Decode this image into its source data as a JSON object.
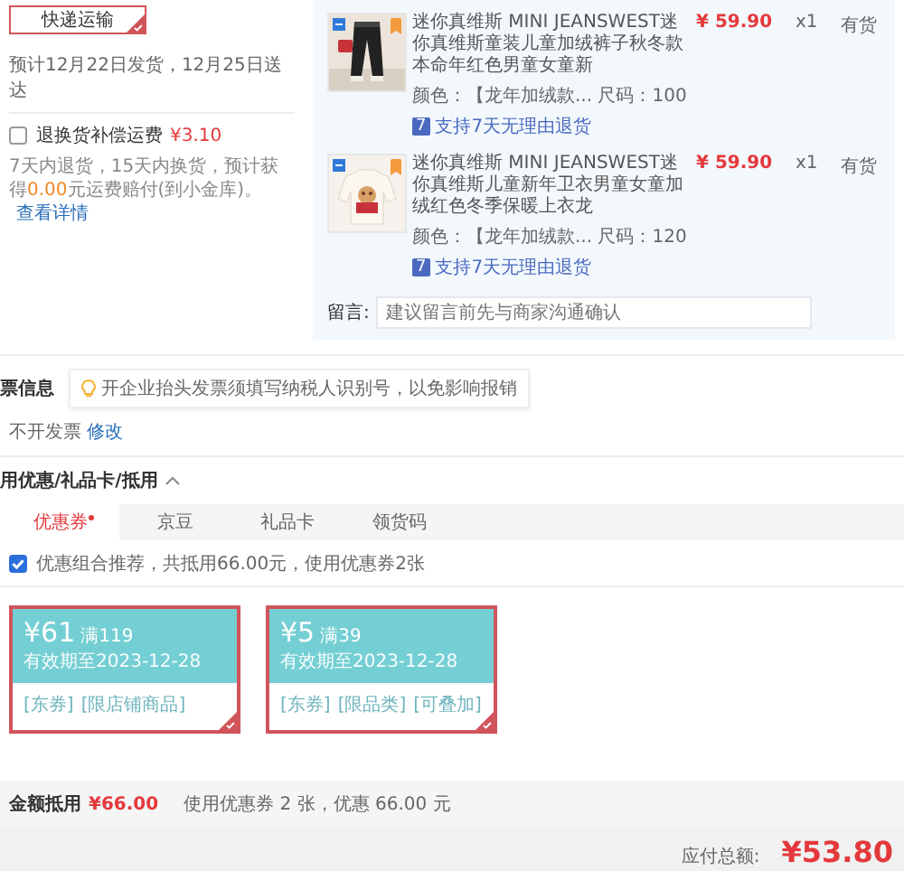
{
  "shipping": {
    "button": "快递运输",
    "selected": true,
    "estimate": "预计12月22日发货，12月25日送达"
  },
  "freight_insurance": {
    "label": "退换货补偿运费",
    "checked": false,
    "price": "¥3.10",
    "description_before": "7天内退货，15天内换货，预计获得",
    "amount": "0.00",
    "description_after": "元运费赔付(到小金库)。",
    "link": "查看详情"
  },
  "products": [
    {
      "title": "迷你真维斯 MINI JEANSWEST迷你真维斯童装儿童加绒裤子秋冬款本命年红色男童女童新",
      "variant": "颜色：【龙年加绒款... 尺码：100",
      "service_badge": "7",
      "service": "支持7天无理由退货",
      "price": "¥ 59.90",
      "quantity": "x1",
      "stock": "有货",
      "kind": "pants"
    },
    {
      "title": "迷你真维斯 MINI JEANSWEST迷你真维斯儿童新年卫衣男童女童加绒红色冬季保暖上衣龙",
      "variant": "颜色：【龙年加绒款... 尺码：120",
      "service_badge": "7",
      "service": "支持7天无理由退货",
      "price": "¥ 59.90",
      "quantity": "x1",
      "stock": "有货",
      "kind": "sweater"
    }
  ],
  "message": {
    "label": "留言:",
    "placeholder": "建议留言前先与商家沟通确认"
  },
  "invoice": {
    "title": "票信息",
    "tip": "开企业抬头发票须填写纳税人识别号，以免影响报销",
    "value": "不开发票",
    "link": "修改"
  },
  "discounts": {
    "title": "用优惠/礼品卡/抵用",
    "expanded": true,
    "tabs": [
      {
        "label": "优惠券",
        "selected": true,
        "badge": true
      },
      {
        "label": "京豆",
        "selected": false,
        "badge": false
      },
      {
        "label": "礼品卡",
        "selected": false,
        "badge": false
      },
      {
        "label": "领货码",
        "selected": false,
        "badge": false
      }
    ],
    "combo": {
      "checked": true,
      "label": "优惠组合推荐，共抵用66.00元，使用优惠券2张"
    },
    "coupons": [
      {
        "amount": "¥61",
        "condition": "满119",
        "validity": "有效期至2023-12-28",
        "tags": [
          "[东券]",
          "[限店铺商品]"
        ],
        "selected": true
      },
      {
        "amount": "¥5",
        "condition": "满39",
        "validity": "有效期至2023-12-28",
        "tags": [
          "[东券]",
          "[限品类]",
          "[可叠加]"
        ],
        "selected": true
      }
    ],
    "summary": {
      "label": "金额抵用",
      "amount": "¥66.00",
      "detail": "使用优惠券 2 张，优惠 66.00 元"
    }
  },
  "total": {
    "label": "应付总额:",
    "amount": "¥53.80"
  }
}
